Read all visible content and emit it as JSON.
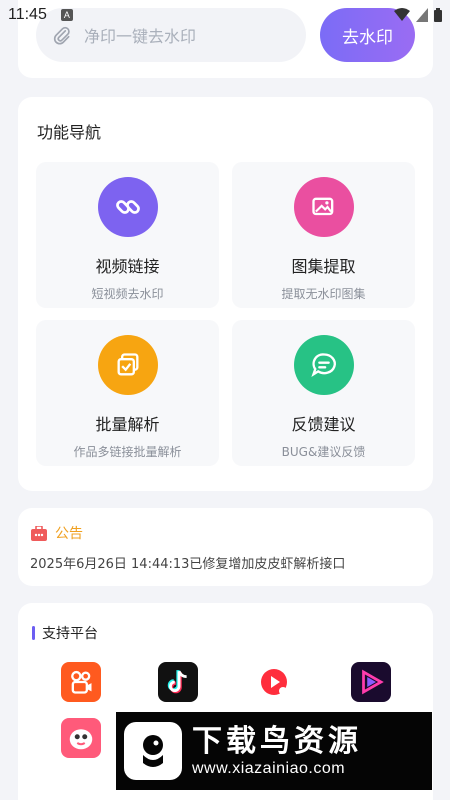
{
  "status_bar": {
    "time": "11:45",
    "a_icon": "A"
  },
  "search": {
    "placeholder": "净印一键去水印",
    "button_label": "去水印"
  },
  "nav": {
    "title": "功能导航",
    "items": [
      {
        "title": "视频链接",
        "subtitle": "短视频去水印",
        "icon": "link-icon",
        "color": "#7d63f0"
      },
      {
        "title": "图集提取",
        "subtitle": "提取无水印图集",
        "icon": "image-icon",
        "color": "#ea4fa0"
      },
      {
        "title": "批量解析",
        "subtitle": "作品多链接批量解析",
        "icon": "batch-icon",
        "color": "#f7a511"
      },
      {
        "title": "反馈建议",
        "subtitle": "BUG&建议反馈",
        "icon": "feedback-icon",
        "color": "#27c285"
      }
    ]
  },
  "notice": {
    "label": "公告",
    "text": "2025年6月26日 14:44:13已修复增加皮皮虾解析接口"
  },
  "platforms": {
    "title": "支持平台",
    "icons": [
      "kuaishou-icon",
      "douyin-icon",
      "weishi-icon",
      "video-app-icon",
      "pipixia-icon"
    ]
  },
  "watermark": {
    "brand": "下载鸟资源",
    "url": "www.xiazainiao.com"
  }
}
